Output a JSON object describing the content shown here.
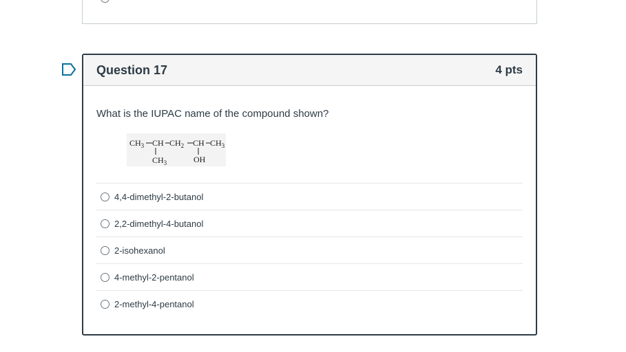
{
  "question": {
    "title": "Question 17",
    "points": "4 pts",
    "text": "What is the IUPAC name of the compound shown?"
  },
  "formula": {
    "main_chain": [
      "CH3",
      "CH",
      "CH2",
      "CH",
      "CH3"
    ],
    "branches": [
      "CH3",
      "OH"
    ]
  },
  "answers": [
    {
      "label": "4,4-dimethyl-2-butanol"
    },
    {
      "label": "2,2-dimethyl-4-butanol"
    },
    {
      "label": "2-isohexanol"
    },
    {
      "label": "4-methyl-2-pentanol"
    },
    {
      "label": "2-methyl-4-pentanol"
    }
  ],
  "icons": {
    "flag": "bookmark-flag-icon",
    "radio": "radio-circle-icon"
  },
  "colors": {
    "text": "#2d3b45",
    "border": "#2d3b45",
    "flag": "#0770a3",
    "header_bg": "#f5f5f5"
  }
}
